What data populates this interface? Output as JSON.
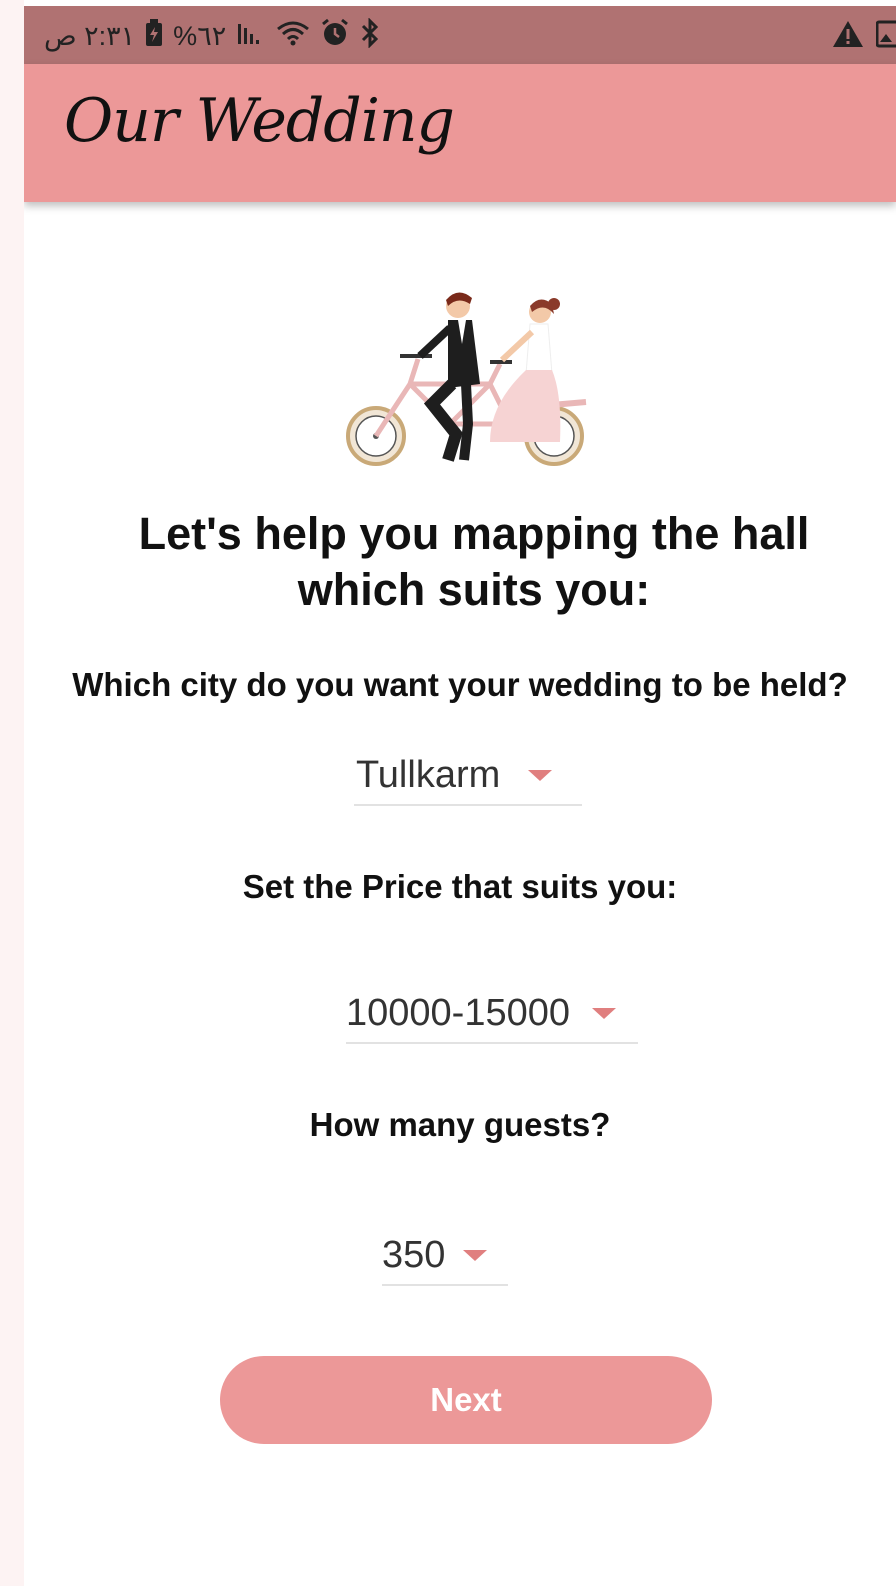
{
  "status_bar": {
    "time": "٢:٣١ ص",
    "battery": "%٦٢",
    "icons": [
      "battery-charging-icon",
      "signal-icon",
      "wifi-icon",
      "alarm-icon",
      "bluetooth-icon",
      "warning-icon",
      "image-icon"
    ]
  },
  "app_bar": {
    "title": "Our Wedding"
  },
  "illustration": {
    "name": "couple-tandem-bicycle-illustration"
  },
  "headline": "Let's help you mapping the hall which suits you:",
  "form": {
    "city_question": "Which city do you want your wedding to be held?",
    "city_value": "Tullkarm",
    "price_question": "Set the Price that suits you:",
    "price_value": "10000-15000",
    "guests_question": "How many guests?",
    "guests_value": "350",
    "next_label": "Next"
  },
  "colors": {
    "accent": "#ec9898",
    "status_bar": "#b07272",
    "caret": "#e07f7f"
  }
}
